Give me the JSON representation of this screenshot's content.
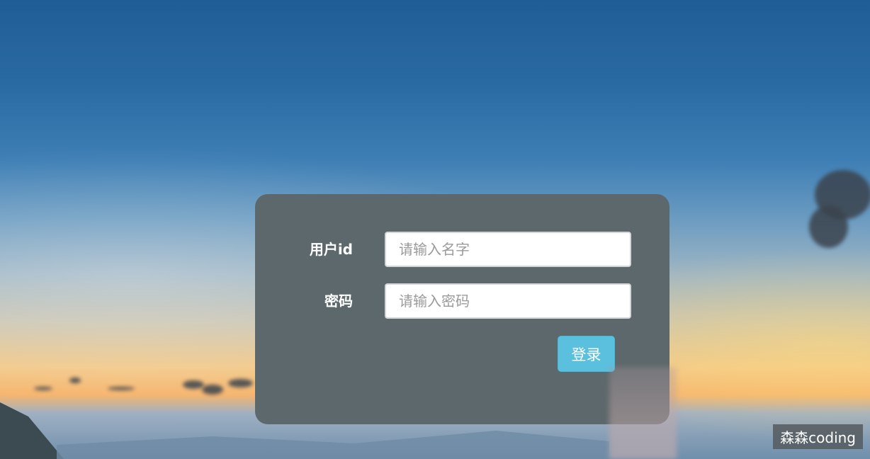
{
  "login_form": {
    "user_id_label": "用户id",
    "user_id_placeholder": "请输入名字",
    "user_id_value": "",
    "password_label": "密码",
    "password_placeholder": "请输入密码",
    "password_value": "",
    "submit_label": "登录"
  },
  "watermark": {
    "text": "森森coding"
  },
  "colors": {
    "card_background": "#5c686b",
    "button_background": "#5bc0de",
    "label_text": "#ffffff"
  }
}
